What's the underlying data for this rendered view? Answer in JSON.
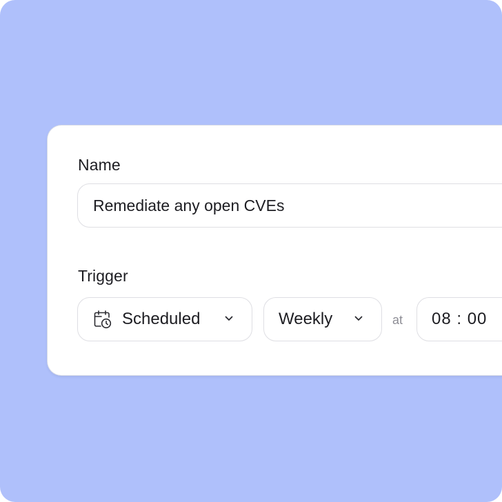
{
  "form": {
    "name_label": "Name",
    "name_value": "Remediate any open CVEs",
    "trigger_label": "Trigger",
    "trigger_type": "Scheduled",
    "frequency": "Weekly",
    "at_label": "at",
    "time": "08 : 00"
  },
  "icons": {
    "trigger_type": "calendar-clock-icon",
    "dropdown": "chevron-down-icon"
  },
  "colors": {
    "background": "#afc0fb",
    "card": "#ffffff",
    "border": "#dedee3"
  }
}
